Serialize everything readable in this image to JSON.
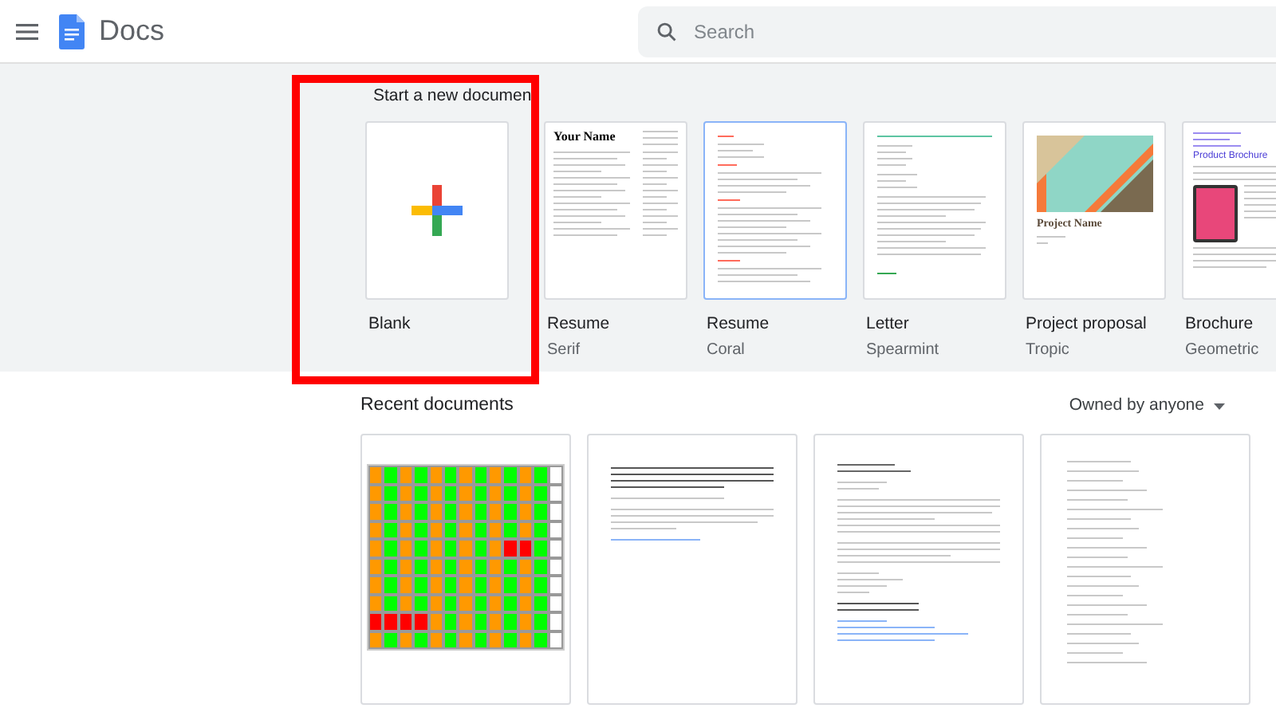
{
  "header": {
    "app_name": "Docs",
    "search": {
      "placeholder": "Search"
    }
  },
  "templates": {
    "title": "Start a new documen",
    "items": [
      {
        "kind": "blank",
        "name": "Blank",
        "selected": false
      },
      {
        "kind": "resume",
        "name": "Resume",
        "subtitle": "Serif",
        "heading": "Your Name",
        "selected": false
      },
      {
        "kind": "resume_coral",
        "name": "Resume",
        "subtitle": "Coral",
        "selected": true
      },
      {
        "kind": "letter",
        "name": "Letter",
        "subtitle": "Spearmint",
        "selected": false
      },
      {
        "kind": "proposal",
        "name": "Project proposal",
        "subtitle": "Tropic",
        "heading": "Project Name",
        "selected": false
      },
      {
        "kind": "brochure",
        "name": "Brochure",
        "subtitle": "Geometric",
        "heading": "Product Brochure",
        "selected": false
      }
    ]
  },
  "recent": {
    "title": "Recent documents",
    "filter": "Owned by anyone",
    "documents": [
      {
        "kind": "sheet"
      },
      {
        "kind": "paper"
      },
      {
        "kind": "letter"
      },
      {
        "kind": "list"
      }
    ]
  }
}
